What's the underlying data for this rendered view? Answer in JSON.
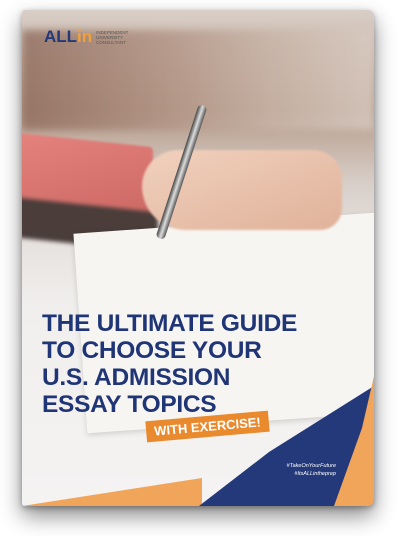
{
  "logo": {
    "brand_text": "ALL in",
    "subtitle": "Independent University Consultant"
  },
  "cover": {
    "title_lines": [
      "THE ULTIMATE GUIDE",
      "TO CHOOSE YOUR",
      "U.S. ADMISSION",
      "ESSAY TOPICS"
    ],
    "badge": "WITH EXERCISE!",
    "hashtags": [
      "#TakeOnYourFuture",
      "#ItsALLintheprep"
    ]
  },
  "colors": {
    "navy": "#1f3575",
    "orange": "#ea8a2e"
  }
}
